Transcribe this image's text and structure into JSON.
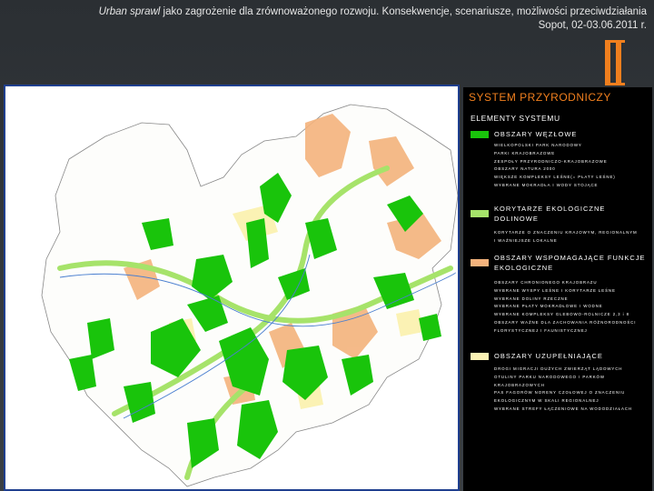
{
  "header": {
    "line1_italic": "Urban sprawl",
    "line1_rest": " jako zagrożenie dla zrównoważonego rozwoju. Konsekwencje, scenariusze, możliwości przeciwdziałania",
    "line2": "Sopot, 02-03.06.2011 r."
  },
  "legend": {
    "title": "SYSTEM PRZYRODNICZY",
    "subtitle": "ELEMENTY SYSTEMU",
    "categories": [
      {
        "label": "OBSZARY WĘZŁOWE",
        "color": "#19c40b",
        "items": [
          "WIELKOPOLSKI PARK NARODOWY",
          "PARKI KRAJOBRAZOWE",
          "ZESPOŁY PRZYRODNICZO-KRAJOBRAZOWE",
          "OBSZARY NATURA 2000",
          "WIĘKSZE KOMPLEKSY LEŚNE(= PŁATY LEŚNE)",
          "WYBRANE MOKRADŁA I WODY STOJĄCE"
        ]
      },
      {
        "label": "KORYTARZE EKOLOGICZNE DOLINOWE",
        "color": "#a6e36a",
        "items": [
          "KORYTARZE O ZNACZENIU KRAJOWYM, REGIONALNYM",
          "I WAŻNIEJSZE LOKALNE"
        ]
      },
      {
        "label": "OBSZARY WSPOMAGAJĄCE FUNKCJE EKOLOGICZNE",
        "color": "#f4b37c",
        "items": [
          "OBSZARY CHRONIONEGO KRAJOBRAZU",
          "WYBRANE WYSPY LEŚNE I KORYTARZE LEŚNE",
          "WYBRANE DOLINY RZECZNE",
          "WYBRANE PŁATY MOKRADŁOWE I WODNE",
          "WYBRANE KOMPLEKSY GLEBOWO-ROLNICZE 2,3 i 8",
          "OBSZARY WAŻNE DLA ZACHOWANIA RÓŻNORODNOŚCI",
          "FLORYSTYCZNEJ I FAUNISTYCZNEJ"
        ]
      },
      {
        "label": "OBSZARY UZUPEŁNIAJĄCE",
        "color": "#fbf2b4",
        "items": [
          "DROGI MIGRACJI DUŻYCH ZWIERZĄT LĄDOWYCH",
          "OTULINY PARKU NARODOWEGO I PARKÓW",
          "KRAJOBRAZOWYCH",
          "PAS FAGORÓW NORENY CZOŁOWEJ O ZNACZENIU",
          "EKOLOGICZNYM W SKALI REGIONALNEJ",
          "WYBRANE STREFY ŁĄCZENIOWE NA WODODZIAŁACH"
        ]
      }
    ]
  }
}
